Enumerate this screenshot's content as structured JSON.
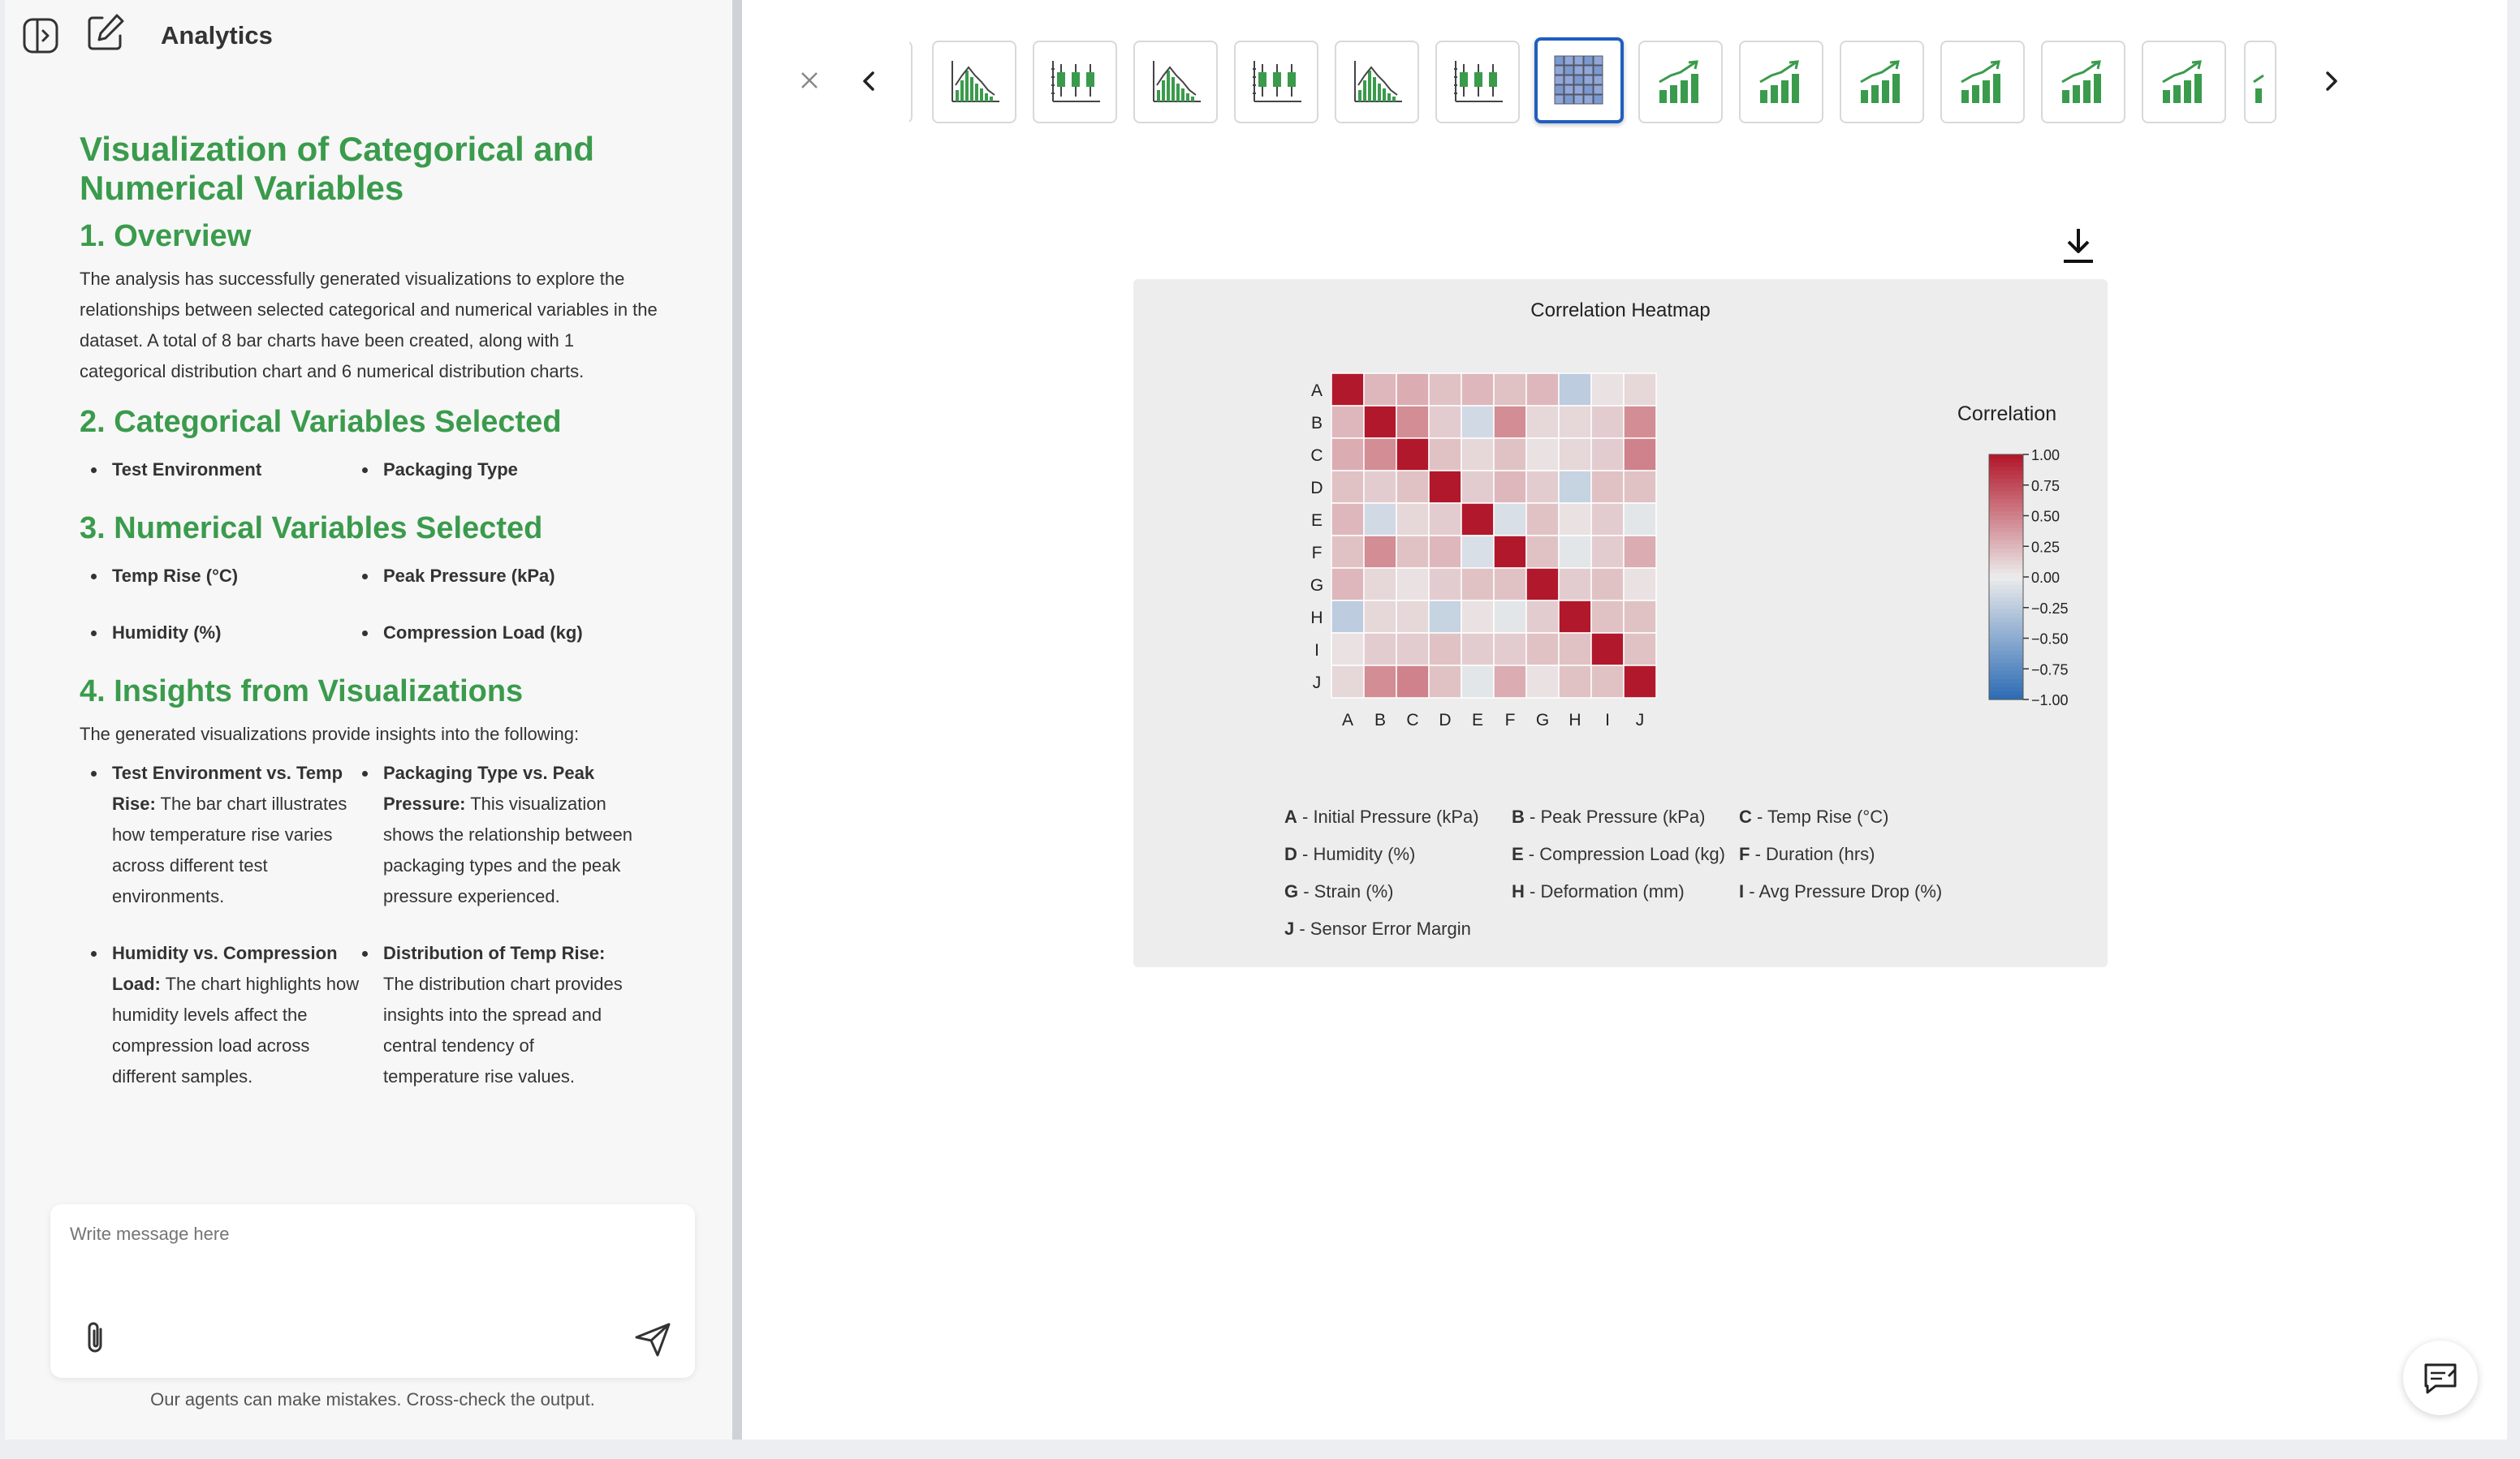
{
  "app": {
    "title": "Analytics"
  },
  "report": {
    "title": "Visualization of Categorical and Numerical Variables",
    "sections": [
      {
        "heading": "1. Overview",
        "text": "The analysis has successfully generated visualizations to explore the relationships between selected categorical and numerical variables in the dataset. A total of 8 bar charts have been created, along with 1 categorical distribution chart and 6 numerical distribution charts."
      },
      {
        "heading": "2. Categorical Variables Selected",
        "items": [
          "Test Environment",
          "Packaging Type"
        ]
      },
      {
        "heading": "3. Numerical Variables Selected",
        "items": [
          "Temp Rise (°C)",
          "Peak Pressure (kPa)",
          "Humidity (%)",
          "Compression Load (kg)"
        ]
      },
      {
        "heading": "4. Insights from Visualizations",
        "text": "The generated visualizations provide insights into the following:",
        "insights": [
          {
            "title": "Test Environment vs. Temp Rise:",
            "body": "The bar chart illustrates how temperature rise varies across different test environments."
          },
          {
            "title": "Packaging Type vs. Peak Pressure:",
            "body": "This visualization shows the relationship between packaging types and the peak pressure experienced."
          },
          {
            "title": "Humidity vs. Compression Load:",
            "body": "The chart highlights how humidity levels affect the compression load across different samples."
          },
          {
            "title": "Distribution of Temp Rise:",
            "body": "The distribution chart provides insights into the spread and central tendency of temperature rise values."
          }
        ]
      }
    ]
  },
  "message": {
    "placeholder": "Write message here",
    "disclaimer": "Our agents can make mistakes. Cross-check the output."
  },
  "thumbnails": {
    "icons": [
      "partial-bar",
      "histogram",
      "boxplot",
      "histogram",
      "boxplot",
      "histogram",
      "boxplot",
      "heatmap",
      "growth-bar",
      "growth-bar",
      "growth-bar",
      "growth-bar",
      "growth-bar",
      "growth-bar",
      "partial-growth"
    ],
    "active_index": 7,
    "accent": "#3a9b4c",
    "active_border": "#1f5fbf"
  },
  "chart_data": {
    "type": "heatmap",
    "title": "Correlation Heatmap",
    "legend_title": "Correlation",
    "rows": [
      "A",
      "B",
      "C",
      "D",
      "E",
      "F",
      "G",
      "H",
      "I",
      "J"
    ],
    "cols": [
      "A",
      "B",
      "C",
      "D",
      "E",
      "F",
      "G",
      "H",
      "I",
      "J"
    ],
    "values": [
      [
        1.0,
        0.25,
        0.3,
        0.2,
        0.25,
        0.2,
        0.25,
        -0.25,
        0.05,
        0.1
      ],
      [
        0.25,
        1.0,
        0.45,
        0.15,
        -0.15,
        0.45,
        0.1,
        0.1,
        0.15,
        0.45
      ],
      [
        0.3,
        0.45,
        1.0,
        0.2,
        0.1,
        0.2,
        0.05,
        0.1,
        0.15,
        0.5
      ],
      [
        0.2,
        0.15,
        0.2,
        1.0,
        0.15,
        0.25,
        0.15,
        -0.2,
        0.2,
        0.2
      ],
      [
        0.25,
        -0.15,
        0.1,
        0.15,
        1.0,
        -0.1,
        0.2,
        0.05,
        0.15,
        -0.05
      ],
      [
        0.2,
        0.45,
        0.2,
        0.25,
        -0.1,
        1.0,
        0.2,
        -0.05,
        0.15,
        0.3
      ],
      [
        0.25,
        0.1,
        0.05,
        0.15,
        0.2,
        0.2,
        1.0,
        0.15,
        0.2,
        0.05
      ],
      [
        -0.25,
        0.1,
        0.1,
        -0.2,
        0.05,
        -0.05,
        0.15,
        1.0,
        0.2,
        0.2
      ],
      [
        0.05,
        0.15,
        0.15,
        0.2,
        0.15,
        0.15,
        0.2,
        0.2,
        1.0,
        0.2
      ],
      [
        0.1,
        0.45,
        0.5,
        0.2,
        -0.05,
        0.3,
        0.05,
        0.2,
        0.2,
        1.0
      ]
    ],
    "colorbar": {
      "min": -1.0,
      "max": 1.0,
      "ticks": [
        "1.00",
        "0.75",
        "0.50",
        "0.25",
        "0.00",
        "−0.25",
        "−0.50",
        "−0.75",
        "−1.00"
      ]
    },
    "colors": {
      "neg": "#2f6db5",
      "mid": "#ececec",
      "pos": "#b2182b"
    },
    "variable_key": [
      {
        "code": "A",
        "label": "Initial Pressure (kPa)"
      },
      {
        "code": "B",
        "label": "Peak Pressure (kPa)"
      },
      {
        "code": "C",
        "label": "Temp Rise (°C)"
      },
      {
        "code": "D",
        "label": "Humidity (%)"
      },
      {
        "code": "E",
        "label": "Compression Load (kg)"
      },
      {
        "code": "F",
        "label": "Duration (hrs)"
      },
      {
        "code": "G",
        "label": "Strain (%)"
      },
      {
        "code": "H",
        "label": "Deformation (mm)"
      },
      {
        "code": "I",
        "label": "Avg Pressure Drop (%)"
      },
      {
        "code": "J",
        "label": "Sensor Error Margin"
      }
    ]
  }
}
